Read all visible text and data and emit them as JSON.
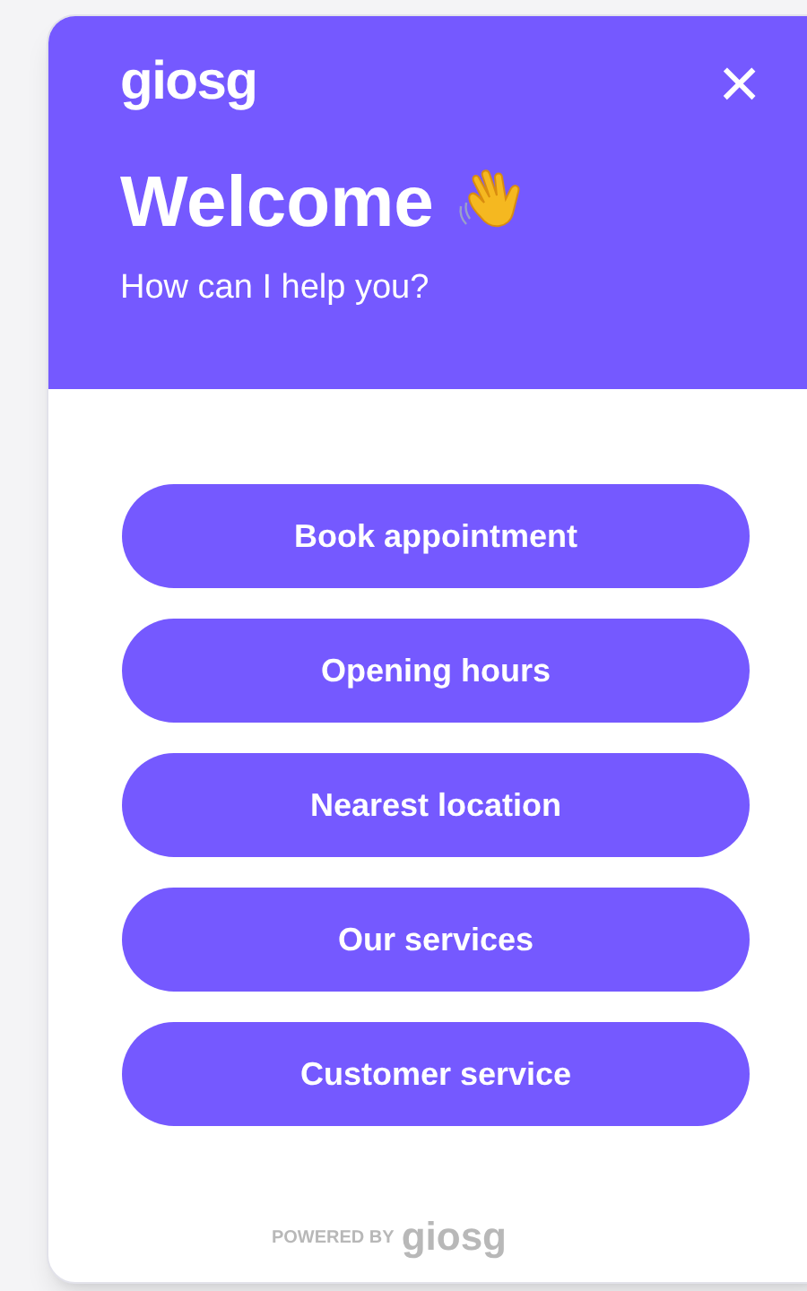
{
  "header": {
    "logo": "giosg",
    "close": "×",
    "title": "Welcome",
    "subtitle": "How can I help you?"
  },
  "buttons": [
    "Book appointment",
    "Opening hours",
    "Nearest location",
    "Our services",
    "Customer service"
  ],
  "footer": {
    "powered_by": "POWERED BY",
    "logo": "giosg"
  }
}
